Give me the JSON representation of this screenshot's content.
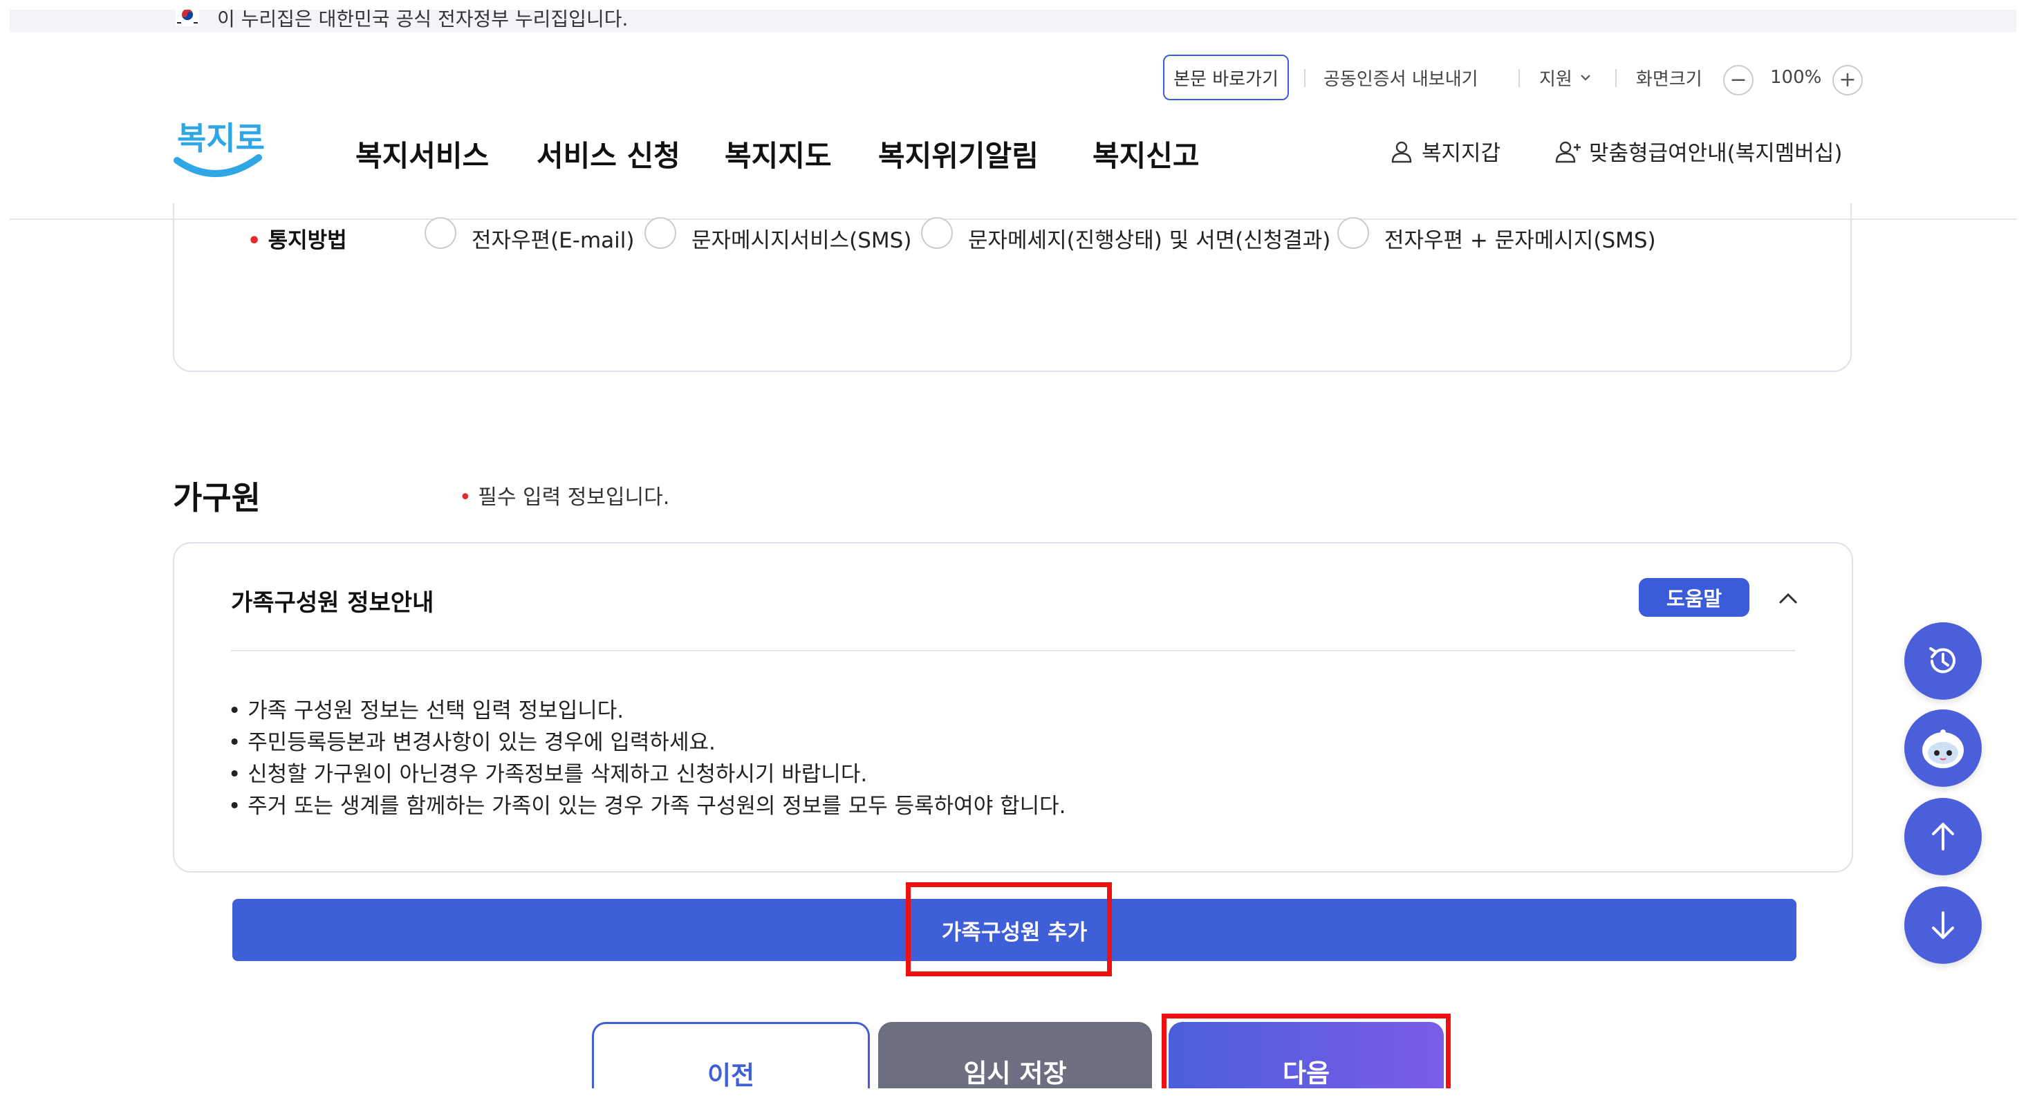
{
  "gov_banner": {
    "text": "이 누리집은 대한민국 공식 전자정부 누리집입니다."
  },
  "header": {
    "utility": {
      "skip_link": "본문 바로가기",
      "cert_export": "공동인증서 내보내기",
      "support": "지원",
      "zoom_label": "화면크기",
      "zoom_value": "100%",
      "zoom_minus": "−",
      "zoom_plus": "+"
    },
    "logo_text": "복지로",
    "nav": [
      "복지서비스",
      "서비스 신청",
      "복지지도",
      "복지위기알림",
      "복지신고"
    ],
    "wallet": "복지지갑",
    "membership": "맞춤형급여안내(복지멤버십)"
  },
  "notification": {
    "label": "통지방법",
    "options": [
      "전자우편(E-mail)",
      "문자메시지서비스(SMS)",
      "문자메세지(진행상태) 및 서면(신청결과)",
      "전자우편 + 문자메시지(SMS)"
    ]
  },
  "household": {
    "title": "가구원",
    "required_note": "필수 입력 정보입니다.",
    "info_card": {
      "title": "가족구성원 정보안내",
      "help_label": "도움말",
      "bullets": [
        "가족 구성원 정보는 선택 입력 정보입니다.",
        "주민등록등본과 변경사항이 있는 경우에 입력하세요.",
        "신청할 가구원이 아닌경우 가족정보를 삭제하고 신청하시기 바랍니다.",
        "주거 또는 생계를 함께하는 가족이 있는 경우 가족 구성원의 정보를 모두 등록하여야 합니다."
      ]
    },
    "add_member_label": "가족구성원 추가"
  },
  "bottom_nav": {
    "prev": "이전",
    "temp_save": "임시 저장",
    "next": "다음"
  },
  "floating": [
    "history-icon",
    "chatbot-icon",
    "arrow-up-icon",
    "arrow-down-icon"
  ],
  "colors": {
    "primary": "#3e5fd8",
    "highlight": "#ee1111",
    "temp_save": "#6b6f7f",
    "next_gradient_start": "#4a5fd9",
    "next_gradient_end": "#7b5ce8",
    "logo": "#2fa6e6"
  }
}
